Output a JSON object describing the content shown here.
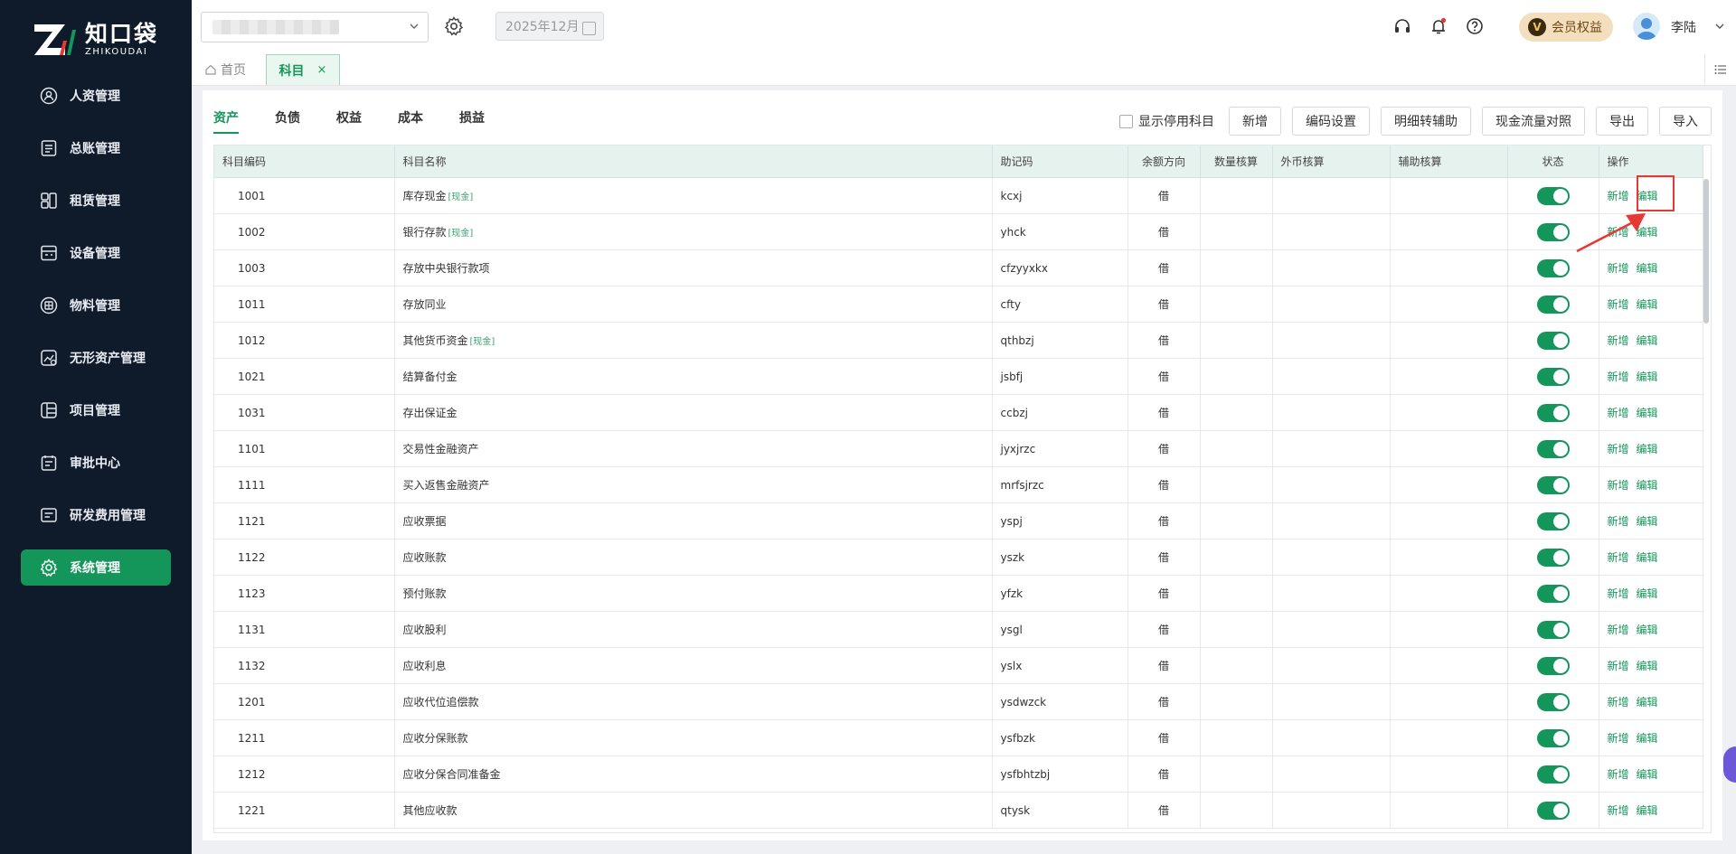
{
  "brand": {
    "cn": "知口袋",
    "en": "ZHIKOUDAI",
    "accent": "#14965a"
  },
  "sidebar": {
    "items": [
      {
        "label": "人资管理",
        "icon": "person-icon"
      },
      {
        "label": "总账管理",
        "icon": "ledger-icon"
      },
      {
        "label": "租赁管理",
        "icon": "lease-icon"
      },
      {
        "label": "设备管理",
        "icon": "device-icon"
      },
      {
        "label": "物料管理",
        "icon": "material-icon"
      },
      {
        "label": "无形资产管理",
        "icon": "intangible-icon"
      },
      {
        "label": "项目管理",
        "icon": "project-icon"
      },
      {
        "label": "审批中心",
        "icon": "approval-icon"
      },
      {
        "label": "研发费用管理",
        "icon": "rd-icon"
      },
      {
        "label": "系统管理",
        "icon": "gear-icon",
        "active": true
      }
    ]
  },
  "header": {
    "period": "2025年12月",
    "member_label": "会员权益",
    "member_badge": "V",
    "username": "李陆"
  },
  "tabs": {
    "home": "首页",
    "active": "科目",
    "close": "×"
  },
  "category_tabs": [
    "资产",
    "负债",
    "权益",
    "成本",
    "损益"
  ],
  "toolbar": {
    "show_disabled": "显示停用科目",
    "buttons": [
      "新增",
      "编码设置",
      "明细转辅助",
      "现金流量对照",
      "导出",
      "导入"
    ]
  },
  "table": {
    "columns": [
      "科目编码",
      "科目名称",
      "助记码",
      "余额方向",
      "数量核算",
      "外币核算",
      "辅助核算",
      "状态",
      "操作"
    ],
    "op_add": "新增",
    "op_edit": "编辑",
    "rows": [
      {
        "code": "1001",
        "name": "库存现金",
        "tag": "[现金]",
        "mnemonic": "kcxj",
        "direction": "借"
      },
      {
        "code": "1002",
        "name": "银行存款",
        "tag": "[现金]",
        "mnemonic": "yhck",
        "direction": "借"
      },
      {
        "code": "1003",
        "name": "存放中央银行款项",
        "tag": "",
        "mnemonic": "cfzyyxkx",
        "direction": "借"
      },
      {
        "code": "1011",
        "name": "存放同业",
        "tag": "",
        "mnemonic": "cfty",
        "direction": "借"
      },
      {
        "code": "1012",
        "name": "其他货币资金",
        "tag": "[现金]",
        "mnemonic": "qthbzj",
        "direction": "借"
      },
      {
        "code": "1021",
        "name": "结算备付金",
        "tag": "",
        "mnemonic": "jsbfj",
        "direction": "借"
      },
      {
        "code": "1031",
        "name": "存出保证金",
        "tag": "",
        "mnemonic": "ccbzj",
        "direction": "借"
      },
      {
        "code": "1101",
        "name": "交易性金融资产",
        "tag": "",
        "mnemonic": "jyxjrzc",
        "direction": "借"
      },
      {
        "code": "1111",
        "name": "买入返售金融资产",
        "tag": "",
        "mnemonic": "mrfsjrzc",
        "direction": "借"
      },
      {
        "code": "1121",
        "name": "应收票据",
        "tag": "",
        "mnemonic": "yspj",
        "direction": "借"
      },
      {
        "code": "1122",
        "name": "应收账款",
        "tag": "",
        "mnemonic": "yszk",
        "direction": "借"
      },
      {
        "code": "1123",
        "name": "预付账款",
        "tag": "",
        "mnemonic": "yfzk",
        "direction": "借"
      },
      {
        "code": "1131",
        "name": "应收股利",
        "tag": "",
        "mnemonic": "ysgl",
        "direction": "借"
      },
      {
        "code": "1132",
        "name": "应收利息",
        "tag": "",
        "mnemonic": "yslx",
        "direction": "借"
      },
      {
        "code": "1201",
        "name": "应收代位追偿款",
        "tag": "",
        "mnemonic": "ysdwzck",
        "direction": "借"
      },
      {
        "code": "1211",
        "name": "应收分保账款",
        "tag": "",
        "mnemonic": "ysfbzk",
        "direction": "借"
      },
      {
        "code": "1212",
        "name": "应收分保合同准备金",
        "tag": "",
        "mnemonic": "ysfbhtzbj",
        "direction": "借"
      },
      {
        "code": "1221",
        "name": "其他应收款",
        "tag": "",
        "mnemonic": "qtysk",
        "direction": "借"
      }
    ]
  }
}
